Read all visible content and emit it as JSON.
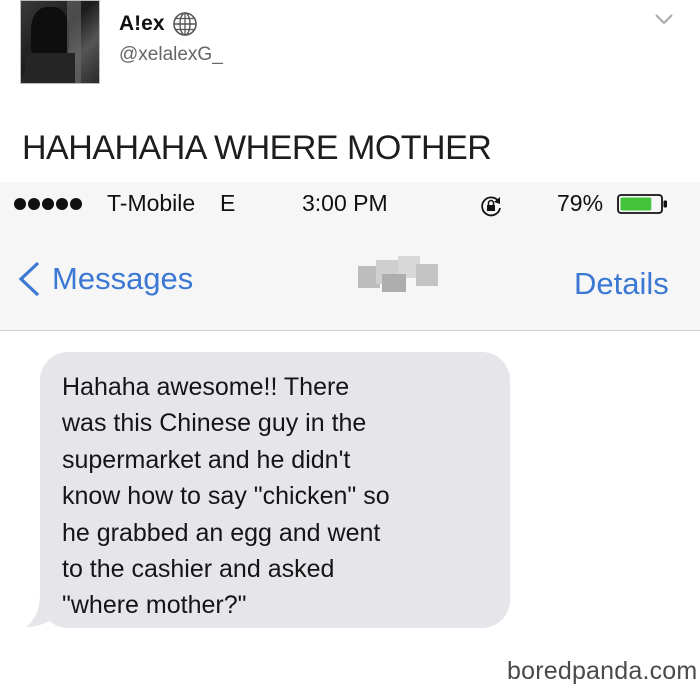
{
  "tweet": {
    "display_name": "A!ex",
    "handle": "@xelalexG_",
    "text": "HAHAHAHA WHERE MOTHER",
    "icons": {
      "verified": "globe-icon",
      "menu": "chevron-down-icon"
    }
  },
  "status_bar": {
    "carrier": "T-Mobile",
    "network": "E",
    "time": "3:00 PM",
    "battery": "79%",
    "battery_level": 0.79,
    "signal_dots": 5
  },
  "nav": {
    "back_label": "Messages",
    "details_label": "Details",
    "contact_name_blurred": true
  },
  "message": {
    "lines": [
      "Hahaha awesome!! There",
      "was this Chinese guy in the",
      "supermarket and he didn't",
      "know how to say \"chicken\" so",
      "he grabbed an egg and went",
      "to the cashier and asked",
      "\"where mother?\""
    ]
  },
  "watermark": "boredpanda.com",
  "colors": {
    "ios_blue": "#3b78d4",
    "bubble": "#e6e5ea",
    "battery_green": "#43c43a"
  }
}
